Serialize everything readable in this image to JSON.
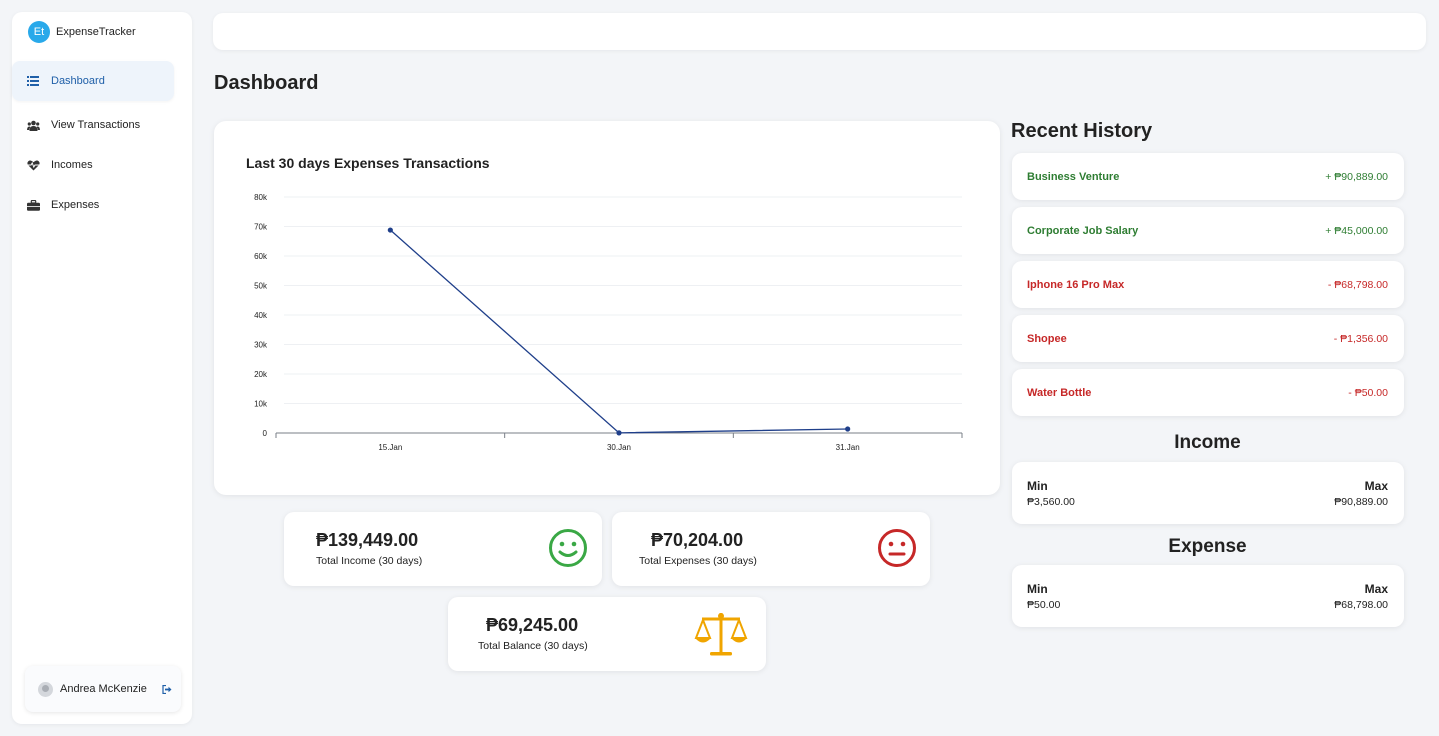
{
  "brand": {
    "logo_text": "Et",
    "name": "ExpenseTracker",
    "accent": "#29a9ea"
  },
  "sidebar": {
    "items": [
      {
        "label": "Dashboard",
        "icon": "list-icon",
        "active": true
      },
      {
        "label": "View Transactions",
        "icon": "users-icon",
        "active": false
      },
      {
        "label": "Incomes",
        "icon": "heartbeat-icon",
        "active": false
      },
      {
        "label": "Expenses",
        "icon": "briefcase-icon",
        "active": false
      }
    ],
    "user": {
      "name": "Andrea McKenzie",
      "logout_icon": "sign-out-icon"
    }
  },
  "page": {
    "title": "Dashboard"
  },
  "chart_data": {
    "type": "line",
    "title": "Last 30 days Expenses Transactions",
    "categories": [
      "15.Jan",
      "30.Jan",
      "31.Jan"
    ],
    "series": [
      {
        "values": [
          68798,
          50,
          1356
        ],
        "color": "#1f3f8a"
      }
    ],
    "y_ticks": [
      "0",
      "10k",
      "20k",
      "30k",
      "40k",
      "50k",
      "60k",
      "70k",
      "80k"
    ],
    "ylim": [
      0,
      80000
    ],
    "grid": true,
    "legend": "none"
  },
  "stats": {
    "income": {
      "value": "₱139,449.00",
      "label": "Total Income (30 days)",
      "icon": "smile-icon",
      "color": "#3aa845"
    },
    "expenses": {
      "value": "₱70,204.00",
      "label": "Total Expenses (30 days)",
      "icon": "neutral-face-icon",
      "color": "#c62828"
    },
    "balance": {
      "value": "₱69,245.00",
      "label": "Total Balance (30 days)",
      "icon": "balance-scale-icon",
      "color": "#f0a500"
    }
  },
  "recent_history": {
    "title": "Recent History",
    "items": [
      {
        "name": "Business Venture",
        "amount": "+ ₱90,889.00",
        "type": "income"
      },
      {
        "name": "Corporate Job Salary",
        "amount": "+ ₱45,000.00",
        "type": "income"
      },
      {
        "name": "Iphone 16 Pro Max",
        "amount": "- ₱68,798.00",
        "type": "expense"
      },
      {
        "name": "Shopee",
        "amount": "- ₱1,356.00",
        "type": "expense"
      },
      {
        "name": "Water Bottle",
        "amount": "- ₱50.00",
        "type": "expense"
      }
    ]
  },
  "income_range": {
    "title": "Income",
    "min_label": "Min",
    "max_label": "Max",
    "min": "₱3,560.00",
    "max": "₱90,889.00"
  },
  "expense_range": {
    "title": "Expense",
    "min_label": "Min",
    "max_label": "Max",
    "min": "₱50.00",
    "max": "₱68,798.00"
  }
}
